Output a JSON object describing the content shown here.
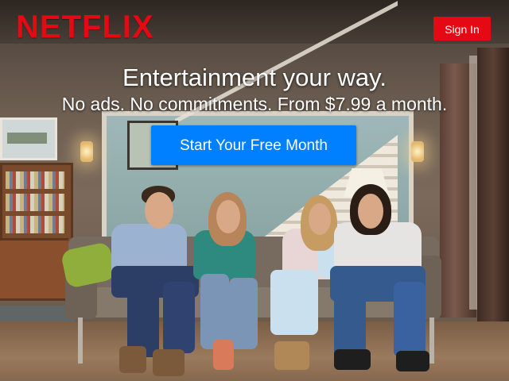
{
  "header": {
    "logo_text": "NETFLIX",
    "sign_in_label": "Sign In"
  },
  "hero": {
    "headline": "Entertainment your way.",
    "subheadline": "No ads. No commitments. From $7.99 a month.",
    "cta_label": "Start Your Free Month"
  },
  "colors": {
    "brand_red": "#e50914",
    "cta_blue": "#0080ff",
    "text_white": "#ffffff"
  }
}
